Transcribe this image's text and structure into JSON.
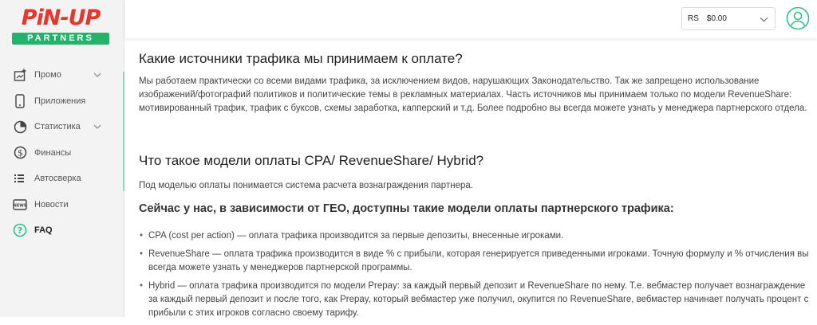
{
  "brand": {
    "logo_top": "PiN-UP",
    "logo_bottom": "PARTNERS",
    "accent": "#2cc28a",
    "logo_red": "#e8362c",
    "logo_green": "#23b36b"
  },
  "sidebar": {
    "items": [
      {
        "label": "Промо",
        "icon": "promo-icon",
        "has_chevron": true
      },
      {
        "label": "Приложения",
        "icon": "phone-icon",
        "has_chevron": false
      },
      {
        "label": "Статистика",
        "icon": "pie-chart-icon",
        "has_chevron": true
      },
      {
        "label": "Финансы",
        "icon": "dollar-icon",
        "has_chevron": false
      },
      {
        "label": "Автосверка",
        "icon": "list-icon",
        "has_chevron": false
      },
      {
        "label": "Новости",
        "icon": "news-icon",
        "has_chevron": false
      },
      {
        "label": "FAQ",
        "icon": "question-icon",
        "has_chevron": false,
        "active": true
      }
    ]
  },
  "header": {
    "currency": "RS",
    "balance": "$0.00"
  },
  "faq": {
    "q1_title": "Какие источники трафика мы принимаем к оплате?",
    "q1_text": "Мы работаем практически со всеми видами трафика, за исключением видов, нарушающих Законодательство. Так же запрещено использование изображений/фотографий политиков и политические темы в рекламных материалах. Часть источников мы принимаем только по модели RevenueShare: мотивированный трафик, трафик с буксов, схемы заработка, капперский и т.д. Более подробно вы всегда можете узнать у менеджера партнерского отдела.",
    "q2_title": "Что такое модели оплаты CPA/ RevenueShare/ Hybrid?",
    "q2_text": "Под моделью оплаты понимается система расчета вознаграждения партнера.",
    "q2_subtitle": "Сейчас у нас, в зависимости от ГЕО, доступны такие модели оплаты партнерского трафика:",
    "models": [
      "CPA (cost per action) — оплата трафика производится за первые депозиты, внесенные игроками.",
      "RevenueShare — оплата трафика производится в виде % с прибыли, которая генерируется приведенными игроками. Точную формулу и % отчисления вы всегда можете узнать у менеджеров партнерской программы.",
      "Hybrid — оплата трафика производится по модели Prepay: за каждый первый депозит и RevenueShare по нему. Т.е. вебмастер получает вознаграждение за каждый первый депозит и после того, как Prepay, который вебмастер уже получил, окупится по RevenueShare, вебмастер начинает получать процент с прибыли с этих игроков согласно своему тарифу."
    ]
  }
}
